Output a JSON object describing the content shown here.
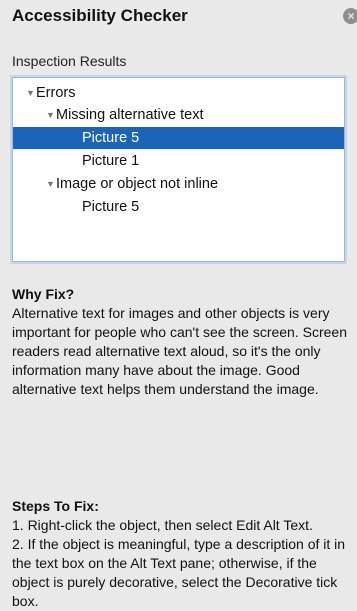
{
  "pane": {
    "title": "Accessibility Checker",
    "close_glyph": "×"
  },
  "inspection": {
    "label": "Inspection Results",
    "tree": [
      {
        "label": "Errors",
        "level": 0,
        "expanded": true,
        "selected": false
      },
      {
        "label": "Missing alternative text",
        "level": 1,
        "expanded": true,
        "selected": false
      },
      {
        "label": "Picture 5",
        "level": 2,
        "selected": true
      },
      {
        "label": "Picture 1",
        "level": 2,
        "selected": false
      },
      {
        "label": "Image or object not inline",
        "level": 1,
        "expanded": true,
        "selected": false
      },
      {
        "label": "Picture 5",
        "level": 2,
        "selected": false
      }
    ]
  },
  "why_fix": {
    "heading": "Why Fix?",
    "body": "Alternative text for images and other objects is very important for people who can't see the screen. Screen readers read alternative text aloud, so it's the only information many have about the image. Good alternative text helps them understand the image."
  },
  "steps_to_fix": {
    "heading": "Steps To Fix:",
    "steps": [
      "1. Right-click the object, then select Edit Alt Text.",
      "2. If the object is meaningful, type a description of it in the text box on the Alt Text pane; otherwise, if the object is purely decorative, select the Decorative tick box."
    ]
  },
  "colors": {
    "selection": "#1c64b8",
    "background": "#e9e9e9"
  }
}
